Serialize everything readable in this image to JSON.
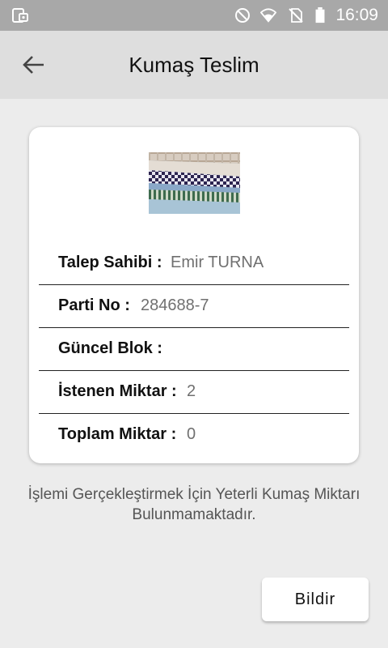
{
  "status_bar": {
    "time": "16:09",
    "icons": [
      "notification-app-icon",
      "do-not-disturb-icon",
      "wifi-icon",
      "no-sim-icon",
      "battery-icon"
    ]
  },
  "header": {
    "title": "Kumaş Teslim",
    "back_icon": "arrow-back-icon"
  },
  "card": {
    "image": "fabric-samples-image",
    "rows": [
      {
        "label": "Talep Sahibi :",
        "value": "Emir TURNA"
      },
      {
        "label": "Parti No :",
        "value": "284688-7"
      },
      {
        "label": "Güncel Blok :",
        "value": ""
      },
      {
        "label": "İstenen Miktar :",
        "value": "2"
      },
      {
        "label": "Toplam Miktar :",
        "value": "0"
      }
    ]
  },
  "message": {
    "line1": "İşlemi Gerçekleştirmek İçin Yeterli Kumaş Miktarı",
    "line2": "Bulunmamaktadır."
  },
  "actions": {
    "notify_label": "Bildir"
  },
  "colors": {
    "status_bar": "#a8a8a8",
    "app_bar": "#dedede",
    "background": "#ececec",
    "card": "#ffffff"
  }
}
